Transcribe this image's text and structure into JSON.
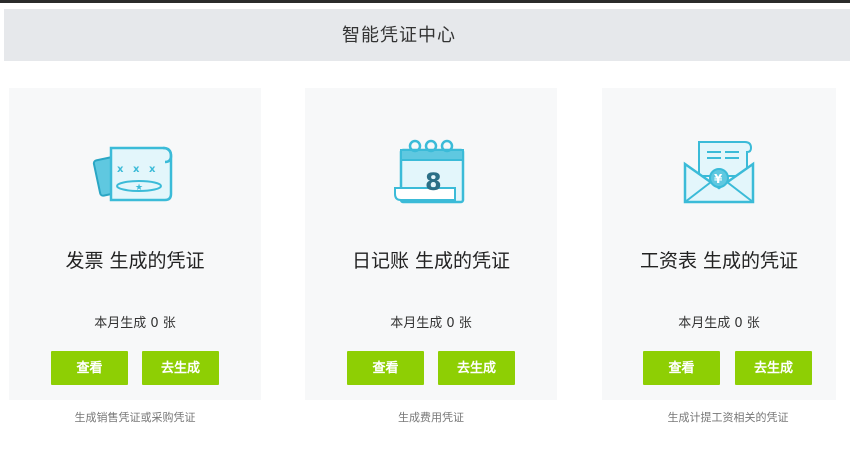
{
  "header": {
    "title": "智能凭证中心"
  },
  "cards": [
    {
      "icon": "invoice-icon",
      "title": "发票 生成的凭证",
      "count": "本月生成 0 张",
      "view_label": "查看",
      "generate_label": "去生成",
      "desc": "生成销售凭证或采购凭证"
    },
    {
      "icon": "journal-calendar-icon",
      "title": "日记账 生成的凭证",
      "count": "本月生成 0 张",
      "view_label": "查看",
      "generate_label": "去生成",
      "desc": "生成费用凭证"
    },
    {
      "icon": "salary-envelope-icon",
      "title": "工资表 生成的凭证",
      "count": "本月生成 0 张",
      "view_label": "查看",
      "generate_label": "去生成",
      "desc": "生成计提工资相关的凭证"
    }
  ],
  "colors": {
    "accent": "#8ecf04",
    "icon_stroke": "#3bbbd8",
    "icon_fill": "#d8f1f8",
    "header_bg": "#e6e8eb",
    "card_bg": "#f7f8f9"
  }
}
